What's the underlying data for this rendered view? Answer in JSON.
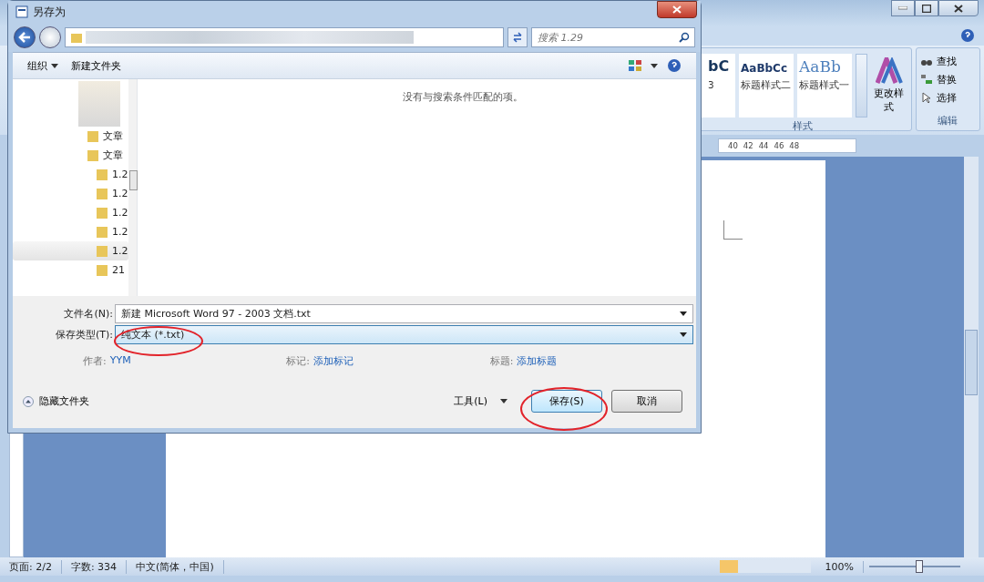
{
  "word": {
    "styles": [
      {
        "preview": "bC",
        "name": "3",
        "kind": "plain"
      },
      {
        "preview": "AaBbCc",
        "name": "标题样式二",
        "kind": "bold"
      },
      {
        "preview": "AaBb",
        "name": "标题样式一",
        "kind": "serif"
      }
    ],
    "change_styles": "更改样式",
    "styles_group": "样式",
    "edit_items": [
      {
        "label": "查找",
        "kind": "find"
      },
      {
        "label": "替换",
        "kind": "replace"
      },
      {
        "label": "选择",
        "kind": "select"
      }
    ],
    "edit_group": "编辑",
    "ruler": [
      "40",
      "42",
      "44",
      "46",
      "48"
    ],
    "status": [
      "页面: 2/2",
      "字数: 334",
      "中文(简体，中国)"
    ],
    "zoom": "100%",
    "zoom_slider": {
      "level": 0.55
    }
  },
  "dialog": {
    "title": "另存为",
    "search": {
      "placeholder": "搜索 1.29"
    },
    "organize": "组织",
    "new_folder": "新建文件夹",
    "empty_message": "没有与搜索条件匹配的项。",
    "nav_items": [
      {
        "label": "文章",
        "selected": false
      },
      {
        "label": "文章",
        "selected": false,
        "children": [
          {
            "label": "1.2",
            "selected": false
          },
          {
            "label": "1.2",
            "selected": false
          },
          {
            "label": "1.2",
            "selected": false
          },
          {
            "label": "1.2",
            "selected": false
          },
          {
            "label": "1.2",
            "selected": true
          },
          {
            "label": "21",
            "selected": false
          }
        ]
      }
    ],
    "fields": [
      {
        "label": "文件名(N):",
        "value": "新建 Microsoft Word 97 - 2003 文档.txt",
        "selected": false
      },
      {
        "label": "保存类型(T):",
        "value": "纯文本 (*.txt)",
        "selected": true
      }
    ],
    "metadata": [
      {
        "label": "作者:",
        "value": "YYM"
      },
      {
        "label": "标记:",
        "value": "添加标记"
      },
      {
        "label": "标题:",
        "value": "添加标题"
      }
    ],
    "hide_folders": "隐藏文件夹",
    "tools": "工具(L)",
    "save": "保存(S)",
    "cancel": "取消"
  }
}
